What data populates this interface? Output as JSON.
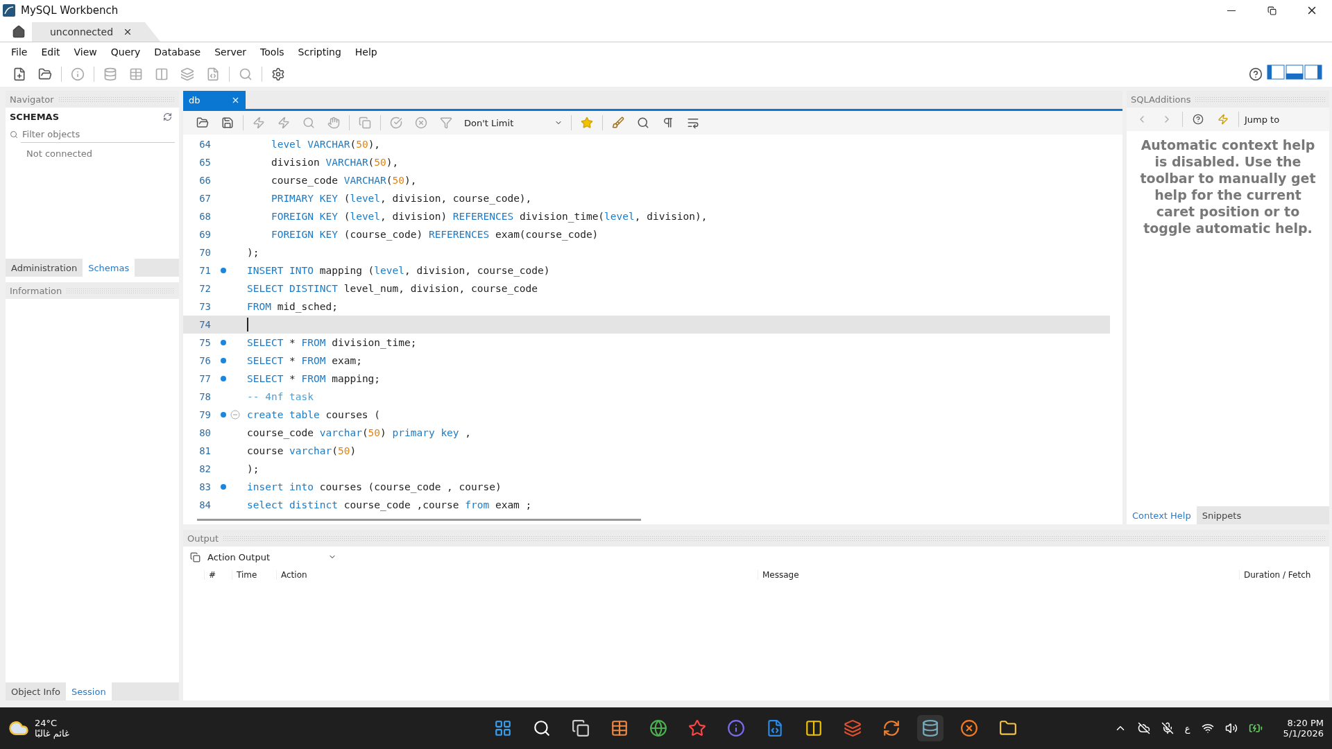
{
  "window": {
    "title": "MySQL Workbench"
  },
  "connection_tabs": [
    {
      "label": "unconnected",
      "selected": true
    }
  ],
  "menu": [
    "File",
    "Edit",
    "View",
    "Query",
    "Database",
    "Server",
    "Tools",
    "Scripting",
    "Help"
  ],
  "navigator": {
    "title": "Navigator",
    "schemas_title": "SCHEMAS",
    "filter": {
      "placeholder": "Filter objects"
    },
    "status": "Not connected",
    "tabs": [
      {
        "label": "Administration",
        "selected": false
      },
      {
        "label": "Schemas",
        "selected": true
      }
    ],
    "information_title": "Information",
    "bottom_tabs": [
      {
        "label": "Object Info",
        "selected": false
      },
      {
        "label": "Session",
        "selected": true
      }
    ]
  },
  "editor": {
    "tabs": [
      {
        "label": "db",
        "selected": true
      }
    ],
    "limit": "Don't Limit",
    "lines": [
      {
        "number": "64",
        "statement": false,
        "current": false,
        "foldable": false,
        "tokens": [
          {
            "kind": "kw",
            "text": "    level"
          },
          {
            "kind": "kw",
            "text": " VARCHAR"
          },
          {
            "kind": "plain",
            "text": "("
          },
          {
            "kind": "num",
            "text": "50"
          },
          {
            "kind": "plain",
            "text": "),"
          }
        ]
      },
      {
        "number": "65",
        "statement": false,
        "current": false,
        "foldable": false,
        "tokens": [
          {
            "kind": "plain",
            "text": "    division "
          },
          {
            "kind": "kw",
            "text": "VARCHAR"
          },
          {
            "kind": "plain",
            "text": "("
          },
          {
            "kind": "num",
            "text": "50"
          },
          {
            "kind": "plain",
            "text": "),"
          }
        ]
      },
      {
        "number": "66",
        "statement": false,
        "current": false,
        "foldable": false,
        "tokens": [
          {
            "kind": "plain",
            "text": "    course_code "
          },
          {
            "kind": "kw",
            "text": "VARCHAR"
          },
          {
            "kind": "plain",
            "text": "("
          },
          {
            "kind": "num",
            "text": "50"
          },
          {
            "kind": "plain",
            "text": "),"
          }
        ]
      },
      {
        "number": "67",
        "statement": false,
        "current": false,
        "foldable": false,
        "tokens": [
          {
            "kind": "kw",
            "text": "    PRIMARY KEY"
          },
          {
            "kind": "plain",
            "text": " ("
          },
          {
            "kind": "kw",
            "text": "level"
          },
          {
            "kind": "plain",
            "text": ", division, course_code),"
          }
        ]
      },
      {
        "number": "68",
        "statement": false,
        "current": false,
        "foldable": false,
        "tokens": [
          {
            "kind": "kw",
            "text": "    FOREIGN KEY"
          },
          {
            "kind": "plain",
            "text": " ("
          },
          {
            "kind": "kw",
            "text": "level"
          },
          {
            "kind": "plain",
            "text": ", division) "
          },
          {
            "kind": "kw",
            "text": "REFERENCES"
          },
          {
            "kind": "plain",
            "text": " division_time("
          },
          {
            "kind": "kw",
            "text": "level"
          },
          {
            "kind": "plain",
            "text": ", division),"
          }
        ]
      },
      {
        "number": "69",
        "statement": false,
        "current": false,
        "foldable": false,
        "tokens": [
          {
            "kind": "kw",
            "text": "    FOREIGN KEY"
          },
          {
            "kind": "plain",
            "text": " (course_code) "
          },
          {
            "kind": "kw",
            "text": "REFERENCES"
          },
          {
            "kind": "plain",
            "text": " exam(course_code)"
          }
        ]
      },
      {
        "number": "70",
        "statement": false,
        "current": false,
        "foldable": false,
        "tokens": [
          {
            "kind": "plain",
            "text": ");"
          }
        ]
      },
      {
        "number": "71",
        "statement": true,
        "current": false,
        "foldable": false,
        "tokens": [
          {
            "kind": "kw",
            "text": "INSERT INTO"
          },
          {
            "kind": "plain",
            "text": " mapping ("
          },
          {
            "kind": "kw",
            "text": "level"
          },
          {
            "kind": "plain",
            "text": ", division, course_code)"
          }
        ]
      },
      {
        "number": "72",
        "statement": false,
        "current": false,
        "foldable": false,
        "tokens": [
          {
            "kind": "kw",
            "text": "SELECT DISTINCT"
          },
          {
            "kind": "plain",
            "text": " level_num, division, course_code"
          }
        ]
      },
      {
        "number": "73",
        "statement": false,
        "current": false,
        "foldable": false,
        "tokens": [
          {
            "kind": "kw",
            "text": "FROM"
          },
          {
            "kind": "plain",
            "text": " mid_sched;"
          }
        ]
      },
      {
        "number": "74",
        "statement": false,
        "current": true,
        "foldable": false
      },
      {
        "number": "75",
        "statement": true,
        "current": false,
        "foldable": false,
        "tokens": [
          {
            "kind": "kw",
            "text": "SELECT"
          },
          {
            "kind": "plain",
            "text": " * "
          },
          {
            "kind": "kw",
            "text": "FROM"
          },
          {
            "kind": "plain",
            "text": " division_time;"
          }
        ]
      },
      {
        "number": "76",
        "statement": true,
        "current": false,
        "foldable": false,
        "tokens": [
          {
            "kind": "kw",
            "text": "SELECT"
          },
          {
            "kind": "plain",
            "text": " * "
          },
          {
            "kind": "kw",
            "text": "FROM"
          },
          {
            "kind": "plain",
            "text": " exam;"
          }
        ]
      },
      {
        "number": "77",
        "statement": true,
        "current": false,
        "foldable": false,
        "tokens": [
          {
            "kind": "kw",
            "text": "SELECT"
          },
          {
            "kind": "plain",
            "text": " * "
          },
          {
            "kind": "kw",
            "text": "FROM"
          },
          {
            "kind": "plain",
            "text": " mapping;"
          }
        ]
      },
      {
        "number": "78",
        "statement": false,
        "current": false,
        "foldable": false,
        "tokens": [
          {
            "kind": "comment",
            "text": "-- 4nf task"
          }
        ]
      },
      {
        "number": "79",
        "statement": true,
        "current": false,
        "foldable": true,
        "tokens": [
          {
            "kind": "kw",
            "text": "create table"
          },
          {
            "kind": "plain",
            "text": " courses ("
          }
        ]
      },
      {
        "number": "80",
        "statement": false,
        "current": false,
        "foldable": false,
        "tokens": [
          {
            "kind": "plain",
            "text": "course_code "
          },
          {
            "kind": "kw",
            "text": "varchar"
          },
          {
            "kind": "plain",
            "text": "("
          },
          {
            "kind": "num",
            "text": "50"
          },
          {
            "kind": "plain",
            "text": ") "
          },
          {
            "kind": "kw",
            "text": "primary key"
          },
          {
            "kind": "plain",
            "text": " ,"
          }
        ]
      },
      {
        "number": "81",
        "statement": false,
        "current": false,
        "foldable": false,
        "tokens": [
          {
            "kind": "plain",
            "text": "course "
          },
          {
            "kind": "kw",
            "text": "varchar"
          },
          {
            "kind": "plain",
            "text": "("
          },
          {
            "kind": "num",
            "text": "50"
          },
          {
            "kind": "plain",
            "text": ")"
          }
        ]
      },
      {
        "number": "82",
        "statement": false,
        "current": false,
        "foldable": false,
        "tokens": [
          {
            "kind": "plain",
            "text": ");"
          }
        ]
      },
      {
        "number": "83",
        "statement": true,
        "current": false,
        "foldable": false,
        "tokens": [
          {
            "kind": "kw",
            "text": "insert into"
          },
          {
            "kind": "plain",
            "text": " courses (course_code , course)"
          }
        ]
      },
      {
        "number": "84",
        "statement": false,
        "current": false,
        "foldable": false,
        "tokens": [
          {
            "kind": "kw",
            "text": "select distinct"
          },
          {
            "kind": "plain",
            "text": " course_code ,course "
          },
          {
            "kind": "kw",
            "text": "from"
          },
          {
            "kind": "plain",
            "text": " exam ;"
          }
        ]
      }
    ]
  },
  "sql_additions": {
    "title": "SQLAdditions",
    "jump_to": "Jump to",
    "help_text": "Automatic context help is disabled. Use the toolbar to manually get help for the current caret position or to toggle automatic help.",
    "tabs": [
      {
        "label": "Context Help",
        "selected": true
      },
      {
        "label": "Snippets",
        "selected": false
      }
    ]
  },
  "output": {
    "title": "Output",
    "mode": "Action Output",
    "columns": [
      "#",
      "Time",
      "Action",
      "Message",
      "Duration / Fetch"
    ]
  },
  "taskbar": {
    "temperature": "24°C",
    "weather": "غائم غالبًا",
    "language": "ع",
    "time": "8:20 PM",
    "date": "5/1/2026"
  }
}
